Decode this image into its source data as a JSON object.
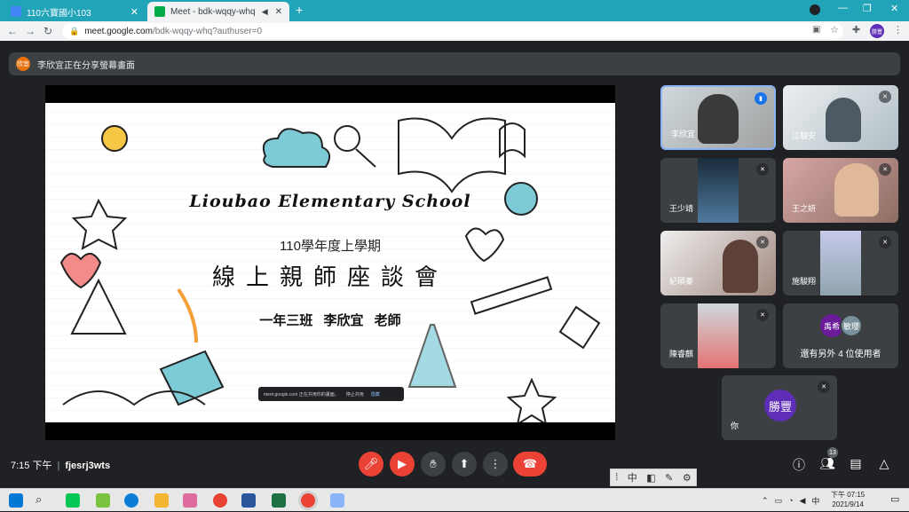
{
  "browser": {
    "tabs": [
      {
        "title": "110六寶國小103",
        "close": "✕"
      },
      {
        "title": "Meet - bdk-wqqy-whq",
        "close": "✕"
      }
    ],
    "new_tab": "+",
    "url_host": "meet.google.com",
    "url_path": "/bdk-wqqy-whq?authuser=0",
    "profile_initials": "勝豐"
  },
  "banner": {
    "avatar": "欣宜",
    "text": "李欣宜正在分享螢幕畫面"
  },
  "slide": {
    "title": "Lioubao Elementary School",
    "subtitle": "110學年度上學期",
    "main": "線上親師座談會",
    "class_line": "一年三班  李欣宜 老師",
    "share_bar_text": "meet.google.com 正在共用你的畫面。",
    "share_bar_stop": "停止共用",
    "share_bar_hide": "隱藏"
  },
  "participants": [
    {
      "name": "李欣宜"
    },
    {
      "name": "江駿安"
    },
    {
      "name": "王少靖"
    },
    {
      "name": "王之妍"
    },
    {
      "name": "紀碩蓁"
    },
    {
      "name": "施駿翔"
    },
    {
      "name": "陳睿麒"
    },
    {
      "others_avatars": [
        "禹希",
        "敏瓔"
      ],
      "others_label": "還有另外 4 位使用者"
    },
    {
      "self_avatar": "勝豐",
      "name": "你"
    }
  ],
  "controls": {
    "time": "7:15 下午",
    "meeting_code": "fjesrj3wts",
    "participant_count": "13"
  },
  "ime": {
    "mode": "中"
  },
  "taskbar": {
    "tray_lang": "中",
    "clock_time": "下午 07:15",
    "clock_date": "2021/9/14"
  },
  "colors": {
    "tab_bar": "#21a3b8",
    "meet_bg": "#202124",
    "tile_bg": "#3c4043",
    "danger": "#ea4335",
    "self_avatar": "#5f2eb8"
  }
}
